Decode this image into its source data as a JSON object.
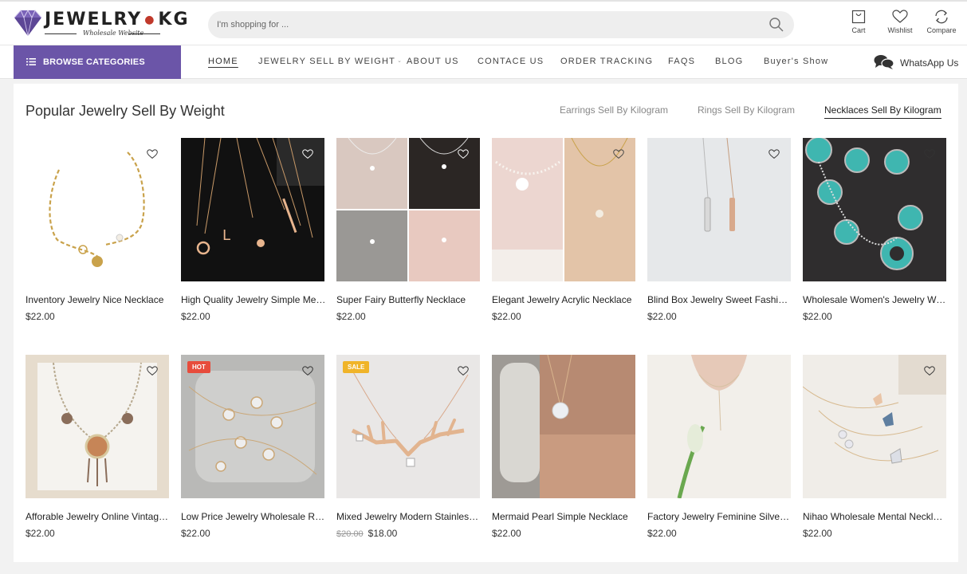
{
  "logo": {
    "brand_left": "JEWELRY",
    "brand_right": "KG",
    "tagline": "Wholesale Website"
  },
  "search": {
    "placeholder": "I'm shopping for ..."
  },
  "header_actions": [
    {
      "label": "Cart",
      "icon": "bag-icon"
    },
    {
      "label": "Wishlist",
      "icon": "heart-icon"
    },
    {
      "label": "Compare",
      "icon": "refresh-icon"
    }
  ],
  "nav": {
    "browse_label": "BROWSE CATEGORIES",
    "items": [
      {
        "label": "HOME",
        "active": true
      },
      {
        "label": "JEWELRY SELL BY WEIGHT",
        "has_dropdown": true
      },
      {
        "label": "ABOUT US"
      },
      {
        "label": "CONTACE US"
      },
      {
        "label": "ORDER TRACKING"
      },
      {
        "label": "FAQS"
      },
      {
        "label": "BLOG"
      },
      {
        "label": "Buyer's Show"
      }
    ],
    "whatsapp_label": "WhatsApp Us"
  },
  "section": {
    "title": "Popular Jewelry Sell By Weight",
    "tabs": [
      {
        "label": "Earrings Sell By Kilogram",
        "active": false
      },
      {
        "label": "Rings Sell By Kilogram",
        "active": false
      },
      {
        "label": "Necklaces Sell By Kilogram",
        "active": true
      }
    ]
  },
  "products": [
    {
      "name": "Inventory Jewelry Nice Necklace",
      "price": "$22.00",
      "image": "gold-chain-necklace"
    },
    {
      "name": "High Quality Jewelry Simple Mental Necklace",
      "price": "$22.00",
      "image": "pendants-on-black"
    },
    {
      "name": "Super Fairy Butterfly Necklace",
      "price": "$22.00",
      "image": "necklace-model-collage"
    },
    {
      "name": "Elegant Jewelry Acrylic Necklace",
      "price": "$22.00",
      "image": "flower-pearl-necklace"
    },
    {
      "name": "Blind Box Jewelry Sweet Fashion Necklace",
      "price": "$22.00",
      "image": "bar-pendants"
    },
    {
      "name": "Wholesale Women's Jewelry Women Necklace",
      "price": "$22.00",
      "image": "turquoise-necklace"
    },
    {
      "name": "Afforable Jewelry Online Vintage Necklace",
      "price": "$22.00",
      "image": "vintage-statement-necklace"
    },
    {
      "name": "Low Price Jewelry Wholesale Ring Necklace",
      "price": "$22.00",
      "image": "pendants-in-tray",
      "badge": "HOT",
      "badge_color": "#e74c3c"
    },
    {
      "name": "Mixed Jewelry Modern Stainless Necklace",
      "old_price": "$20.00",
      "price": "$18.00",
      "image": "antler-necklace",
      "badge": "SALE",
      "badge_color": "#f0b429"
    },
    {
      "name": "Mermaid Pearl Simple Necklace",
      "price": "$22.00",
      "image": "pearl-drop-necklace"
    },
    {
      "name": "Factory Jewelry Feminine Silver Necklace",
      "price": "$22.00",
      "image": "y-chain-necklace"
    },
    {
      "name": "Nihao Wholesale Mental Necklace",
      "price": "$22.00",
      "image": "butterfly-crystal-necklaces"
    }
  ],
  "colors": {
    "accent": "#6b55a8",
    "hot": "#e74c3c",
    "sale": "#f0b429"
  }
}
